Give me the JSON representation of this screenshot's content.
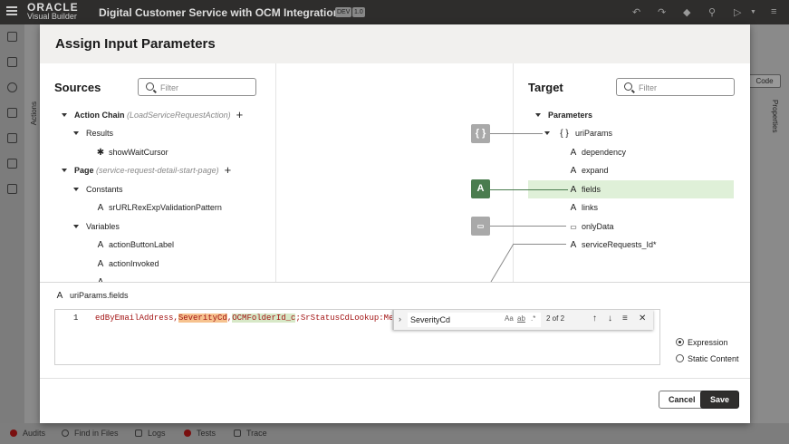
{
  "app": {
    "brand_line1": "ORACLE",
    "brand_line2": "Visual Builder",
    "title": "Digital Customer Service with OCM Integration",
    "badge_dev": "DEV",
    "badge_version": "1.0"
  },
  "background": {
    "code_button": "Code",
    "properties_tab": "Properties",
    "actions_tab": "Actions"
  },
  "bottom_bar": {
    "audits": "Audits",
    "find_in_files": "Find in Files",
    "logs": "Logs",
    "tests": "Tests",
    "trace": "Trace"
  },
  "dialog": {
    "title": "Assign Input Parameters",
    "sources": {
      "title": "Sources",
      "filter_placeholder": "Filter",
      "tree": {
        "action_chain_label": "Action Chain",
        "action_chain_sub": "(LoadServiceRequestAction)",
        "results": "Results",
        "show_wait_cursor": "showWaitCursor",
        "page_label": "Page",
        "page_sub": "(service-request-detail-start-page)",
        "constants": "Constants",
        "sr_url_regexp": "srURLRexExpValidationPattern",
        "variables": "Variables",
        "action_button_label": "actionButtonLabel",
        "action_invoked": "actionInvoked"
      }
    },
    "target": {
      "title": "Target",
      "filter_placeholder": "Filter",
      "tree": {
        "parameters": "Parameters",
        "uri_params": "uriParams",
        "dependency": "dependency",
        "expand": "expand",
        "fields": "fields",
        "links": "links",
        "only_data": "onlyData",
        "service_requests_id": "serviceRequests_Id*"
      }
    },
    "mapping": {
      "box_object": "{ }",
      "box_string": "A"
    },
    "expression": {
      "path_label": "uriParams.fields",
      "line_number": "1",
      "code_part1": "edByEmailAddress,",
      "code_match1": "SeverityCd",
      "code_part2": ",",
      "code_match2": "OCMFolderId_c",
      "code_part3": ";SrStatusCdLookup:Meaning",
      "find_value": "SeverityCd",
      "find_match_case": "Aa",
      "find_whole_word": "ab",
      "find_regex": ".*",
      "find_count": "2 of 2",
      "radio_expression": "Expression",
      "radio_static": "Static Content"
    },
    "footer": {
      "cancel_label": "Cancel",
      "save_label": "Save"
    }
  }
}
